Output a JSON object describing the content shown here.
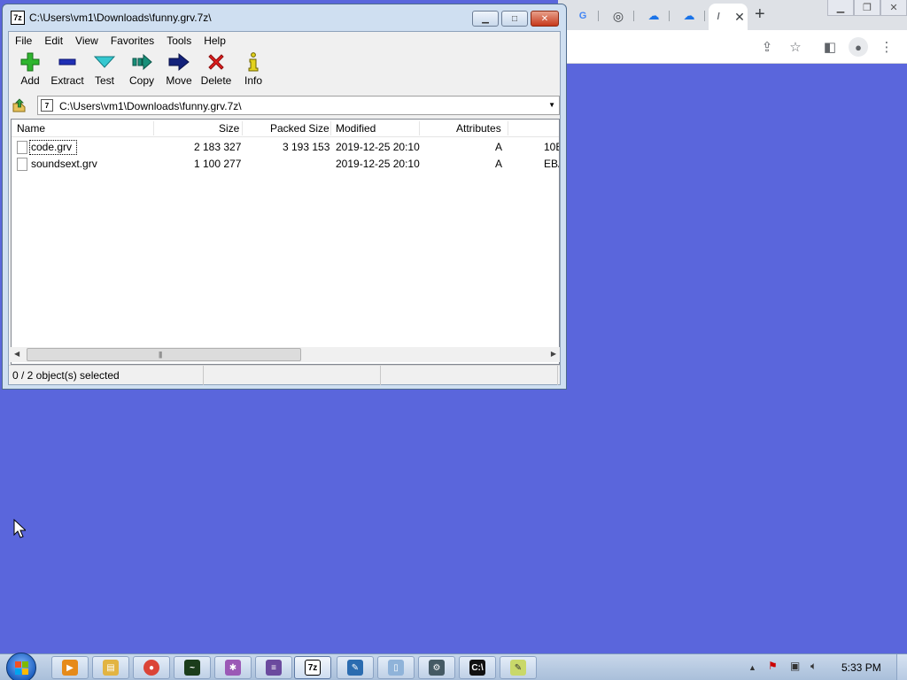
{
  "chrome": {
    "tabs": [
      {
        "icon": "google-icon",
        "glyph": "G"
      },
      {
        "icon": "chrome-icon",
        "glyph": "◎"
      },
      {
        "icon": "cloud-upload-icon",
        "glyph": "☁"
      },
      {
        "icon": "cloud-upload-icon",
        "glyph": "☁"
      },
      {
        "icon": "slash-icon",
        "glyph": "/"
      }
    ],
    "new_tab_glyph": "+",
    "close_tab_glyph": "✕"
  },
  "sevenzip": {
    "title": "C:\\Users\\vm1\\Downloads\\funny.grv.7z\\",
    "icon_label": "7z",
    "menu": [
      "File",
      "Edit",
      "View",
      "Favorites",
      "Tools",
      "Help"
    ],
    "toolbar": {
      "add": "Add",
      "extract": "Extract",
      "test": "Test",
      "copy": "Copy",
      "move": "Move",
      "delete": "Delete",
      "info": "Info"
    },
    "address": "C:\\Users\\vm1\\Downloads\\funny.grv.7z\\",
    "columns": {
      "name": "Name",
      "size": "Size",
      "packed": "Packed Size",
      "modified": "Modified",
      "attributes": "Attributes"
    },
    "files": [
      {
        "name": "code.grv",
        "size": "2 183 327",
        "packed": "3 193 153",
        "modified": "2019-12-25 20:10",
        "attributes": "A",
        "extra": "10E"
      },
      {
        "name": "soundsext.grv",
        "size": "1 100 277",
        "packed": "",
        "modified": "2019-12-25 20:10",
        "attributes": "A",
        "extra": "EBA"
      }
    ],
    "status": "0 / 2 object(s) selected"
  },
  "taskbar": {
    "clock": "5:33 PM"
  },
  "colors": {
    "desktop": "#5a66dc",
    "selection_outline": "#000000"
  }
}
